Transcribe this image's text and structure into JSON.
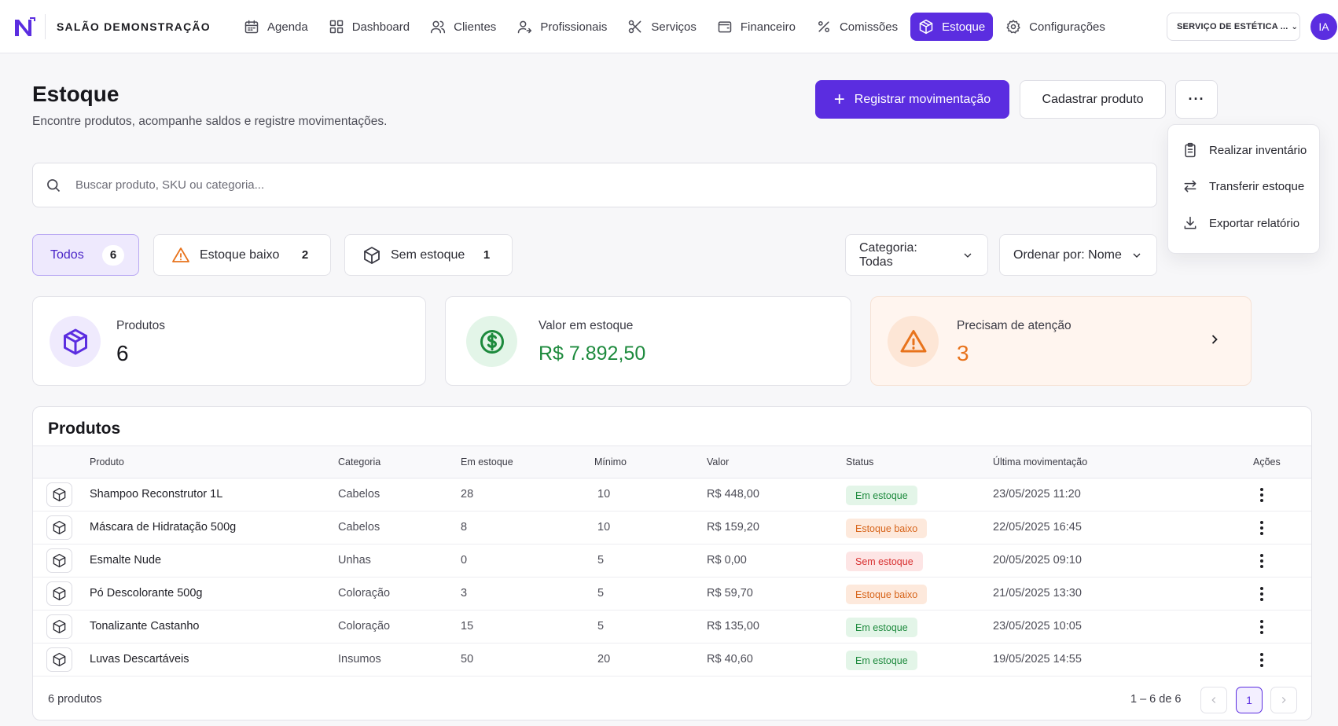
{
  "app": {
    "brand": "SALÃO DEMONSTRAÇÃO",
    "unit_selector": "SERVIÇO DE ESTÉTICA ...",
    "avatar_initials": "IA"
  },
  "nav": [
    {
      "label": "Agenda",
      "icon": "calendar-icon",
      "active": false
    },
    {
      "label": "Dashboard",
      "icon": "grid-icon",
      "active": false
    },
    {
      "label": "Clientes",
      "icon": "users-icon",
      "active": false
    },
    {
      "label": "Profissionais",
      "icon": "user-arrow-icon",
      "active": false
    },
    {
      "label": "Serviços",
      "icon": "scissors-icon",
      "active": false
    },
    {
      "label": "Financeiro",
      "icon": "wallet-icon",
      "active": false
    },
    {
      "label": "Comissões",
      "icon": "percent-icon",
      "active": false
    },
    {
      "label": "Estoque",
      "icon": "box-icon",
      "active": true
    },
    {
      "label": "Configurações",
      "icon": "gear-icon",
      "active": false
    }
  ],
  "header": {
    "title": "Estoque",
    "subtitle": "Encontre produtos, acompanhe saldos e registre movimentações.",
    "primary_button": "Registrar movimentação",
    "secondary_button": "Cadastrar produto",
    "more_button": "···"
  },
  "more_menu": [
    {
      "label": "Realizar inventário",
      "icon": "clipboard-icon"
    },
    {
      "label": "Transferir estoque",
      "icon": "transfer-icon"
    },
    {
      "label": "Exportar relatório",
      "icon": "download-icon"
    }
  ],
  "search": {
    "placeholder": "Buscar produto, SKU ou categoria...",
    "value": ""
  },
  "filters": [
    {
      "label": "Todos",
      "count": "6",
      "active": true
    },
    {
      "label": "Estoque baixo",
      "count": "2",
      "active": false
    },
    {
      "label": "Sem estoque",
      "count": "1",
      "active": false
    }
  ],
  "selects": {
    "category": "Categoria: Todas",
    "order": "Ordenar por: Nome"
  },
  "stats": {
    "products": {
      "label": "Produtos",
      "value": "6"
    },
    "stock_value": {
      "label": "Valor em estoque",
      "value": "R$ 7.892,50"
    },
    "attention": {
      "label": "Precisam de atenção",
      "value": "3"
    }
  },
  "colors": {
    "accent": "#5b2de0",
    "success": "#1d8a3d",
    "warning": "#e8731c",
    "danger": "#d83131"
  },
  "table": {
    "title": "Produtos",
    "columns": [
      "Produto",
      "Categoria",
      "Em estoque",
      "Mínimo",
      "Valor",
      "Status",
      "Última movimentação",
      "Ações"
    ],
    "rows": [
      {
        "name": "Shampoo Reconstrutor 1L",
        "category": "Cabelos",
        "stock": "28",
        "min": "10",
        "value": "R$ 448,00",
        "status": "Em estoque",
        "status_type": "ok",
        "last": "23/05/2025 11:20"
      },
      {
        "name": "Máscara de Hidratação 500g",
        "category": "Cabelos",
        "stock": "8",
        "min": "10",
        "value": "R$ 159,20",
        "status": "Estoque baixo",
        "status_type": "low",
        "last": "22/05/2025 16:45"
      },
      {
        "name": "Esmalte Nude",
        "category": "Unhas",
        "stock": "0",
        "min": "5",
        "value": "R$ 0,00",
        "status": "Sem estoque",
        "status_type": "out",
        "last": "20/05/2025 09:10"
      },
      {
        "name": "Pó Descolorante 500g",
        "category": "Coloração",
        "stock": "3",
        "min": "5",
        "value": "R$ 59,70",
        "status": "Estoque baixo",
        "status_type": "low",
        "last": "21/05/2025 13:30"
      },
      {
        "name": "Tonalizante Castanho",
        "category": "Coloração",
        "stock": "15",
        "min": "5",
        "value": "R$ 135,00",
        "status": "Em estoque",
        "status_type": "ok",
        "last": "23/05/2025 10:05"
      },
      {
        "name": "Luvas Descartáveis",
        "category": "Insumos",
        "stock": "50",
        "min": "20",
        "value": "R$ 40,60",
        "status": "Em estoque",
        "status_type": "ok",
        "last": "19/05/2025 14:55"
      }
    ],
    "footer_total": "6 produtos",
    "footer_range": "1 – 6 de 6",
    "current_page": "1"
  }
}
